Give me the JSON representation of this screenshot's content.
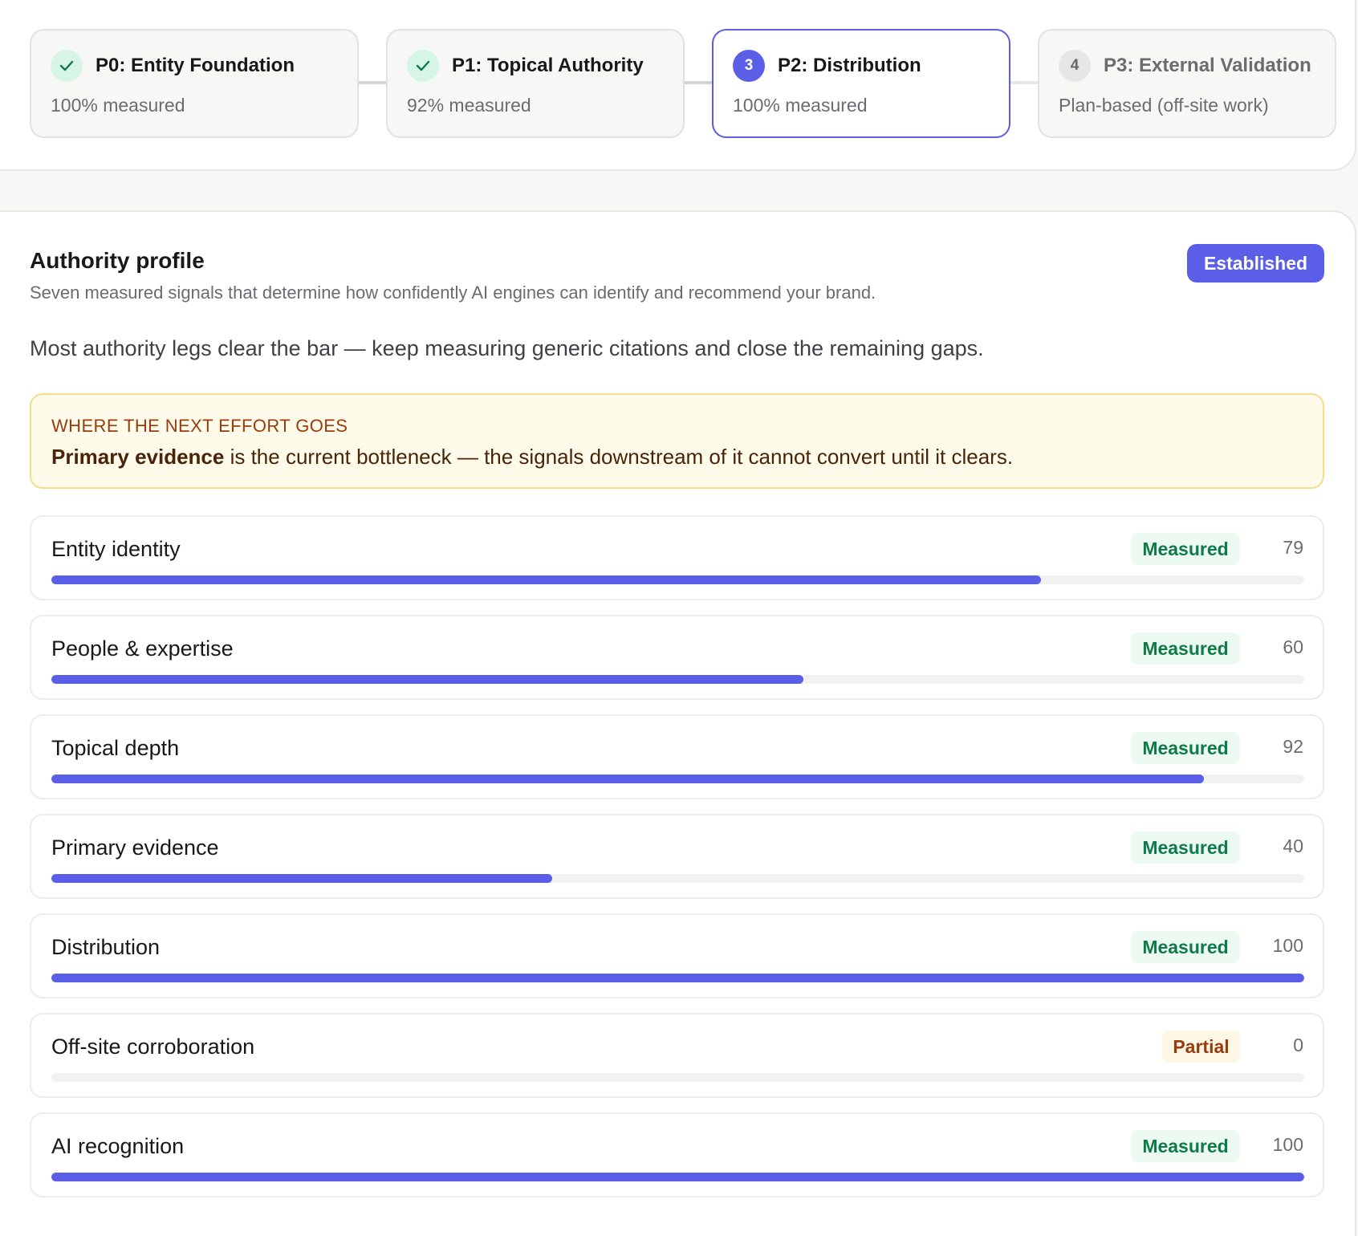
{
  "phases": [
    {
      "title": "P0: Entity Foundation",
      "subtitle": "100% measured",
      "state": "done",
      "icon": "check-icon"
    },
    {
      "title": "P1: Topical Authority",
      "subtitle": "92% measured",
      "state": "done",
      "icon": "check-icon"
    },
    {
      "title": "P2: Distribution",
      "subtitle": "100% measured",
      "state": "current",
      "number": "3"
    },
    {
      "title": "P3: External Validation",
      "subtitle": "Plan-based (off-site work)",
      "state": "todo",
      "number": "4"
    }
  ],
  "profile": {
    "title": "Authority profile",
    "description": "Seven measured signals that determine how confidently AI engines can identify and recommend your brand.",
    "status": "Established",
    "summary": "Most authority legs clear the bar — keep measuring generic citations and close the remaining gaps."
  },
  "callout": {
    "label": "WHERE THE NEXT EFFORT GOES",
    "emphasis": "Primary evidence",
    "text": " is the current bottleneck — the signals downstream of it cannot convert until it clears."
  },
  "signals": [
    {
      "name": "Entity identity",
      "status": "Measured",
      "score": 79
    },
    {
      "name": "People & expertise",
      "status": "Measured",
      "score": 60
    },
    {
      "name": "Topical depth",
      "status": "Measured",
      "score": 92
    },
    {
      "name": "Primary evidence",
      "status": "Measured",
      "score": 40
    },
    {
      "name": "Distribution",
      "status": "Measured",
      "score": 100
    },
    {
      "name": "Off-site corroboration",
      "status": "Partial",
      "score": 0
    },
    {
      "name": "AI recognition",
      "status": "Measured",
      "score": 100
    }
  ],
  "colors": {
    "accent": "#5b5ee6",
    "measured": "#0f7a4a",
    "partial": "#9a3b0c"
  }
}
